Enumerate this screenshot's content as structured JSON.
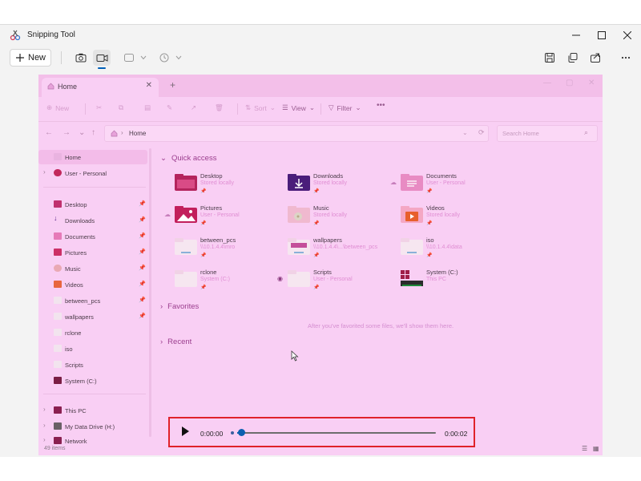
{
  "snipping_tool": {
    "title": "Snipping Tool",
    "new_label": "New",
    "icons": [
      "snipping-tool-app-icon",
      "minimize-icon",
      "maximize-icon",
      "close-icon",
      "camera-icon",
      "video-icon",
      "snip-shape-icon",
      "chevron-down-icon",
      "timer-icon",
      "save-icon",
      "copy-icon",
      "share-icon",
      "more-icon"
    ],
    "active_mode": "video"
  },
  "explorer": {
    "tab_label": "Home",
    "command_bar": {
      "new": "New",
      "sort": "Sort",
      "view": "View",
      "filter": "Filter"
    },
    "address": {
      "crumb": "Home"
    },
    "search_placeholder": "Search Home",
    "nav": [
      {
        "label": "Home",
        "selected": true
      },
      {
        "label": "User - Personal"
      },
      {
        "label": "Desktop",
        "pinned": true
      },
      {
        "label": "Downloads",
        "pinned": true
      },
      {
        "label": "Documents",
        "pinned": true
      },
      {
        "label": "Pictures",
        "pinned": true
      },
      {
        "label": "Music",
        "pinned": true
      },
      {
        "label": "Videos",
        "pinned": true
      },
      {
        "label": "between_pcs",
        "pinned": true
      },
      {
        "label": "wallpapers",
        "pinned": true
      },
      {
        "label": "rclone"
      },
      {
        "label": "iso"
      },
      {
        "label": "Scripts"
      },
      {
        "label": "System (C:)"
      },
      {
        "label": "This PC"
      },
      {
        "label": "My Data Drive (H:)"
      },
      {
        "label": "Network"
      }
    ],
    "sections": {
      "quick_access": "Quick access",
      "favorites": "Favorites",
      "recent": "Recent"
    },
    "quick_access": [
      {
        "name": "Desktop",
        "sub": "Stored locally"
      },
      {
        "name": "Downloads",
        "sub": "Stored locally"
      },
      {
        "name": "Documents",
        "sub": "User - Personal"
      },
      {
        "name": "Pictures",
        "sub": "User - Personal"
      },
      {
        "name": "Music",
        "sub": "Stored locally"
      },
      {
        "name": "Videos",
        "sub": "Stored locally"
      },
      {
        "name": "between_pcs",
        "sub": "\\\\10.1.4.4\\mro"
      },
      {
        "name": "wallpapers",
        "sub": "\\\\10.1.4.4\\...\\between_pcs"
      },
      {
        "name": "iso",
        "sub": "\\\\10.1.4.4\\data"
      },
      {
        "name": "rclone",
        "sub": "System (C:)"
      },
      {
        "name": "Scripts",
        "sub": "User - Personal"
      },
      {
        "name": "System (C:)",
        "sub": "This PC"
      }
    ],
    "favorites_empty": "After you've favorited some files, we'll show them here.",
    "status_count": "49 items"
  },
  "player": {
    "current_time": "0:00:00",
    "total_time": "0:00:02",
    "progress": 0.02
  },
  "colors": {
    "capture_tint": "#f9cff4",
    "highlight": "#e0222a",
    "accent": "#005fb8"
  }
}
